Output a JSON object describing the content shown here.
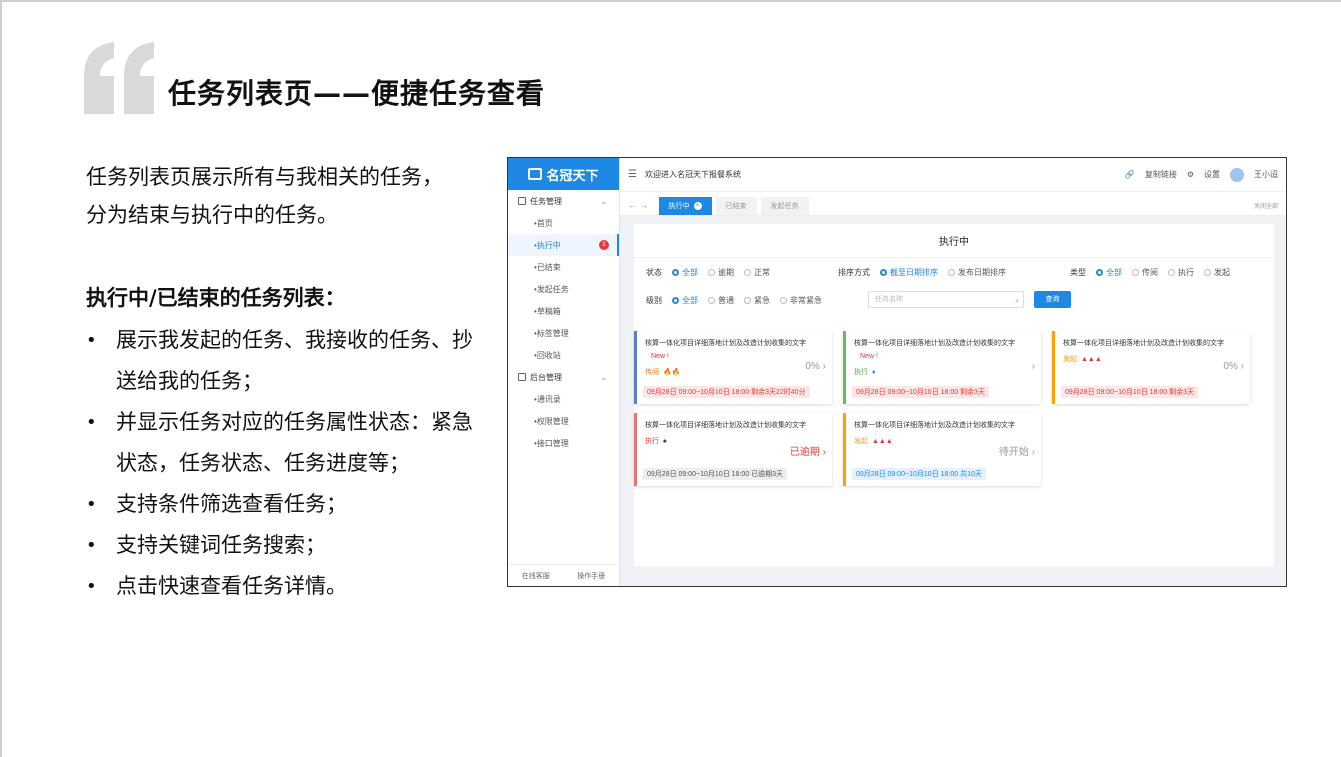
{
  "slide": {
    "title": "任务列表页——便捷任务查看",
    "intro_line1": "任务列表页展示所有与我相关的任务，",
    "intro_line2": "分为结束与执行中的任务。",
    "subhead": "执行中/已结束的任务列表：",
    "bullets": [
      {
        "text": "展示我发起的任务、我接收的任务、抄送给我的任务；"
      },
      {
        "text": "并显示任务对应的任务属性状态：紧急状态，任务状态、任务进度等；"
      },
      {
        "text": "支持条件筛选查看任务；"
      },
      {
        "text": "支持关键词任务搜索；"
      },
      {
        "text": "点击快速查看任务详情。"
      }
    ],
    "bullet_glyph": "•"
  },
  "app": {
    "logo": "名冠天下",
    "welcome": "欢迎进入名冠天下报餐系统",
    "copy_link": "复制链接",
    "settings": "设置",
    "user": "王小迢",
    "menu": {
      "group1": "任务管理",
      "items1": [
        "首页",
        "执行中",
        "已结束",
        "发起任务",
        "草稿箱",
        "标签管理",
        "回收站"
      ],
      "badge": "2",
      "group2": "后台管理",
      "items2": [
        "通讯录",
        "权限管理",
        "接口管理"
      ]
    },
    "footer_left": "在线客服",
    "footer_right": "操作手册",
    "tabs": [
      "执行中",
      "已结束",
      "发起任务"
    ],
    "close_all": "关闭全部",
    "panel_title": "执行中",
    "filters": {
      "status_label": "状态",
      "status": [
        "全部",
        "逾期",
        "正常"
      ],
      "sort_label": "排序方式",
      "sort": [
        "截至日期排序",
        "发布日期排序"
      ],
      "type_label": "类型",
      "type": [
        "全部",
        "传阅",
        "执行",
        "发起"
      ],
      "level_label": "级别",
      "level": [
        "全部",
        "普通",
        "紧急",
        "非常紧急"
      ]
    },
    "search_placeholder": "任务名称",
    "query": "查询",
    "tasks": [
      {
        "title": "核算一体化项目详细落地计划及改造计划收集的文字",
        "new": "New !",
        "state": "传阅",
        "progress": "0%",
        "date": "09月28日 09:00~10月10日 18:00  剩余3天22时40分"
      },
      {
        "title": "核算一体化项目详细落地计划及改造计划收集的文字",
        "new": "New !",
        "state": "执行",
        "progress": "",
        "date": "09月28日 09:00~10月10日 18:00  剩余3天"
      },
      {
        "title": "核算一体化项目详细落地计划及改造计划收集的文字",
        "new": "",
        "state": "发起",
        "progress": "0%",
        "date": "09月28日 09:00~10月10日 18:00  剩余3天"
      },
      {
        "title": "核算一体化项目详细落地计划及改造计划收集的文字",
        "new": "",
        "state": "执行",
        "progress": "已逾期",
        "date": "09月28日 09:00~10月10日 18:00  已逾期3天"
      },
      {
        "title": "核算一体化项目详细落地计划及改造计划收集的文字",
        "new": "",
        "state": "发起",
        "progress": "待开始",
        "date": "09月28日 09:00~10月10日 18:00  共10天"
      }
    ],
    "colors": {
      "accent": "#1e88e5",
      "overdue": "#e53935"
    }
  }
}
